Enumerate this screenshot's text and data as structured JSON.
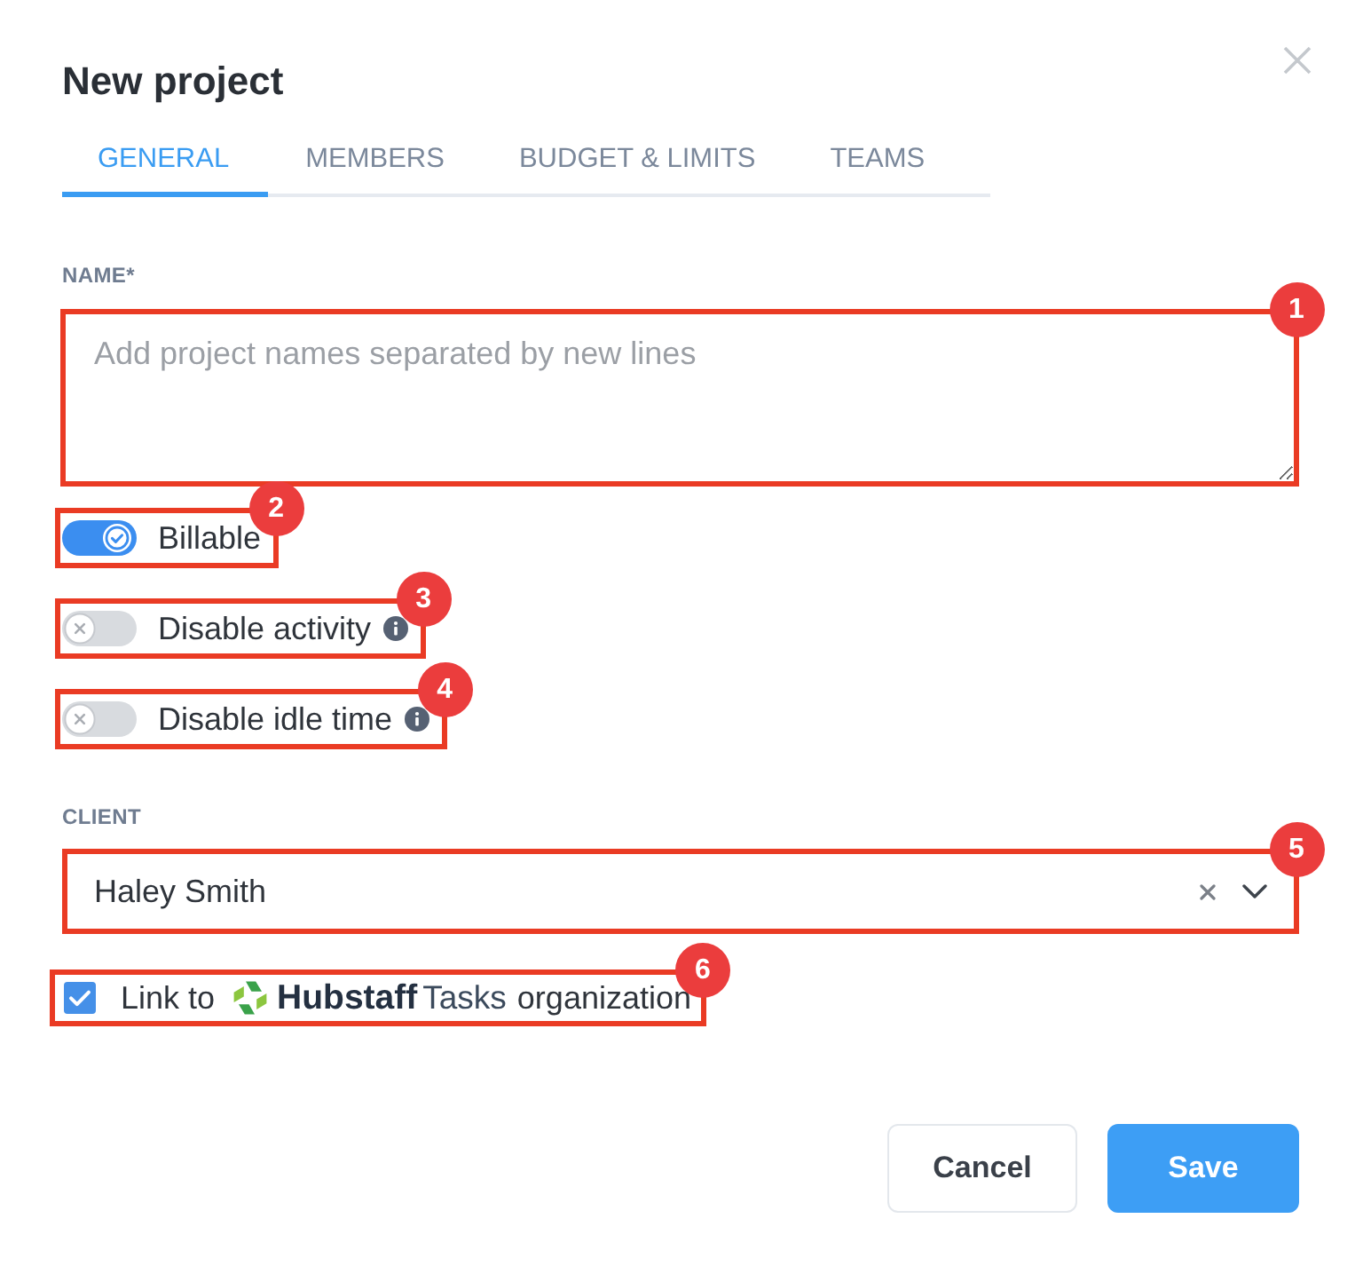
{
  "dialog": {
    "title": "New project"
  },
  "tabs": [
    {
      "label": "GENERAL",
      "selected": true
    },
    {
      "label": "MEMBERS",
      "selected": false
    },
    {
      "label": "BUDGET & LIMITS",
      "selected": false
    },
    {
      "label": "TEAMS",
      "selected": false
    }
  ],
  "name_field": {
    "label": "NAME*",
    "placeholder": "Add project names separated by new lines",
    "callout": "1"
  },
  "toggles": [
    {
      "label": "Billable",
      "on": true,
      "info": false,
      "callout": "2"
    },
    {
      "label": "Disable activity",
      "on": false,
      "info": true,
      "callout": "3"
    },
    {
      "label": "Disable idle time",
      "on": false,
      "info": true,
      "callout": "4"
    }
  ],
  "client_field": {
    "label": "CLIENT",
    "value": "Haley Smith",
    "callout": "5"
  },
  "link_option": {
    "checked": true,
    "prefix": "Link to",
    "brand": "Hubstaff",
    "product": "Tasks",
    "suffix": "organization",
    "callout": "6"
  },
  "buttons": [
    {
      "label": "Cancel",
      "kind": "secondary"
    },
    {
      "label": "Save",
      "kind": "primary"
    }
  ]
}
